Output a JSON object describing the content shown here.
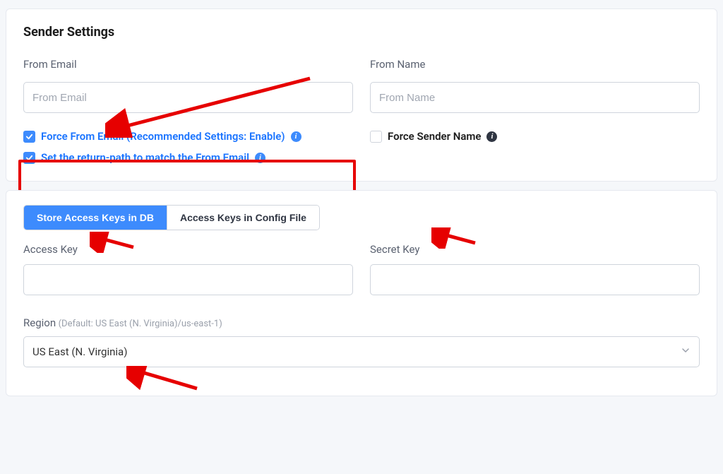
{
  "sender": {
    "title": "Sender Settings",
    "from_email_label": "From Email",
    "from_email_placeholder": "From Email",
    "from_email_value": "",
    "from_name_label": "From Name",
    "from_name_placeholder": "From Name",
    "from_name_value": "",
    "force_from_email_label": "Force From Email (Recommended Settings: Enable)",
    "force_from_email_checked": true,
    "return_path_label": "Set the return-path to match the From Email",
    "return_path_checked": true,
    "force_sender_name_label": "Force Sender Name",
    "force_sender_name_checked": false
  },
  "keys": {
    "tabs": {
      "store_db": "Store Access Keys in DB",
      "config_file": "Access Keys in Config File"
    },
    "access_key_label": "Access Key",
    "access_key_value": "",
    "secret_key_label": "Secret Key",
    "secret_key_value": "",
    "region_label": "Region",
    "region_hint": "(Default: US East (N. Virginia)/us-east-1)",
    "region_value": "US East (N. Virginia)"
  }
}
